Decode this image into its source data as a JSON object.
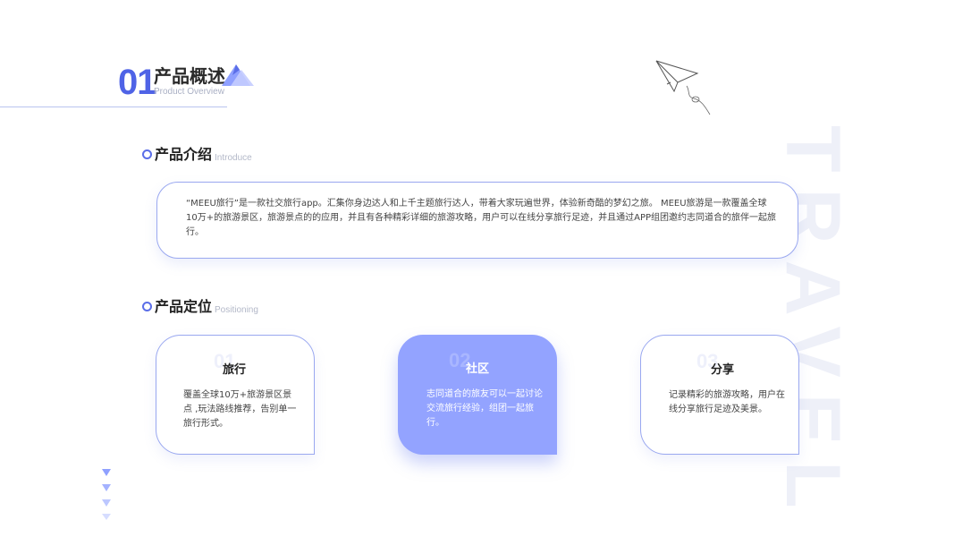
{
  "header": {
    "number": "01",
    "title": "产品概述",
    "subtitle": "Product Overview"
  },
  "watermark": "TRAVEL",
  "intro": {
    "title": "产品介绍",
    "subtitle": "Introduce",
    "text": "“MEEU旅行”是一款社交旅行app。汇集你身边达人和上千主题旅行达人，带着大家玩遍世界，体验新奇酷的梦幻之旅。 MEEU旅游是一款覆盖全球10万+的旅游景区，旅游景点的的应用，并且有各种精彩详细的旅游攻略，用户可以在线分享旅行足迹，并且通过APP组团邀约志同道合的旅伴一起旅行。"
  },
  "positioning": {
    "title": "产品定位",
    "subtitle": "Positioning",
    "cards": [
      {
        "num": "01",
        "title": "旅行",
        "desc": "覆盖全球10万+旅游景区景点 ,玩法路线推荐，告别单一旅行形式。"
      },
      {
        "num": "02",
        "title": "社区",
        "desc": "志同道合的旅友可以一起讨论交流旅行经验，组团一起旅行。"
      },
      {
        "num": "03",
        "title": "分享",
        "desc": "记录精彩的旅游攻略，用户在线分享旅行足迹及美景。"
      }
    ]
  },
  "colors": {
    "accent": "#4f63e6",
    "card_active": "#93a3ff",
    "border": "#9aa8f0"
  },
  "icons": [
    "mountain-icon",
    "paper-plane-icon",
    "down-arrow-icon"
  ]
}
